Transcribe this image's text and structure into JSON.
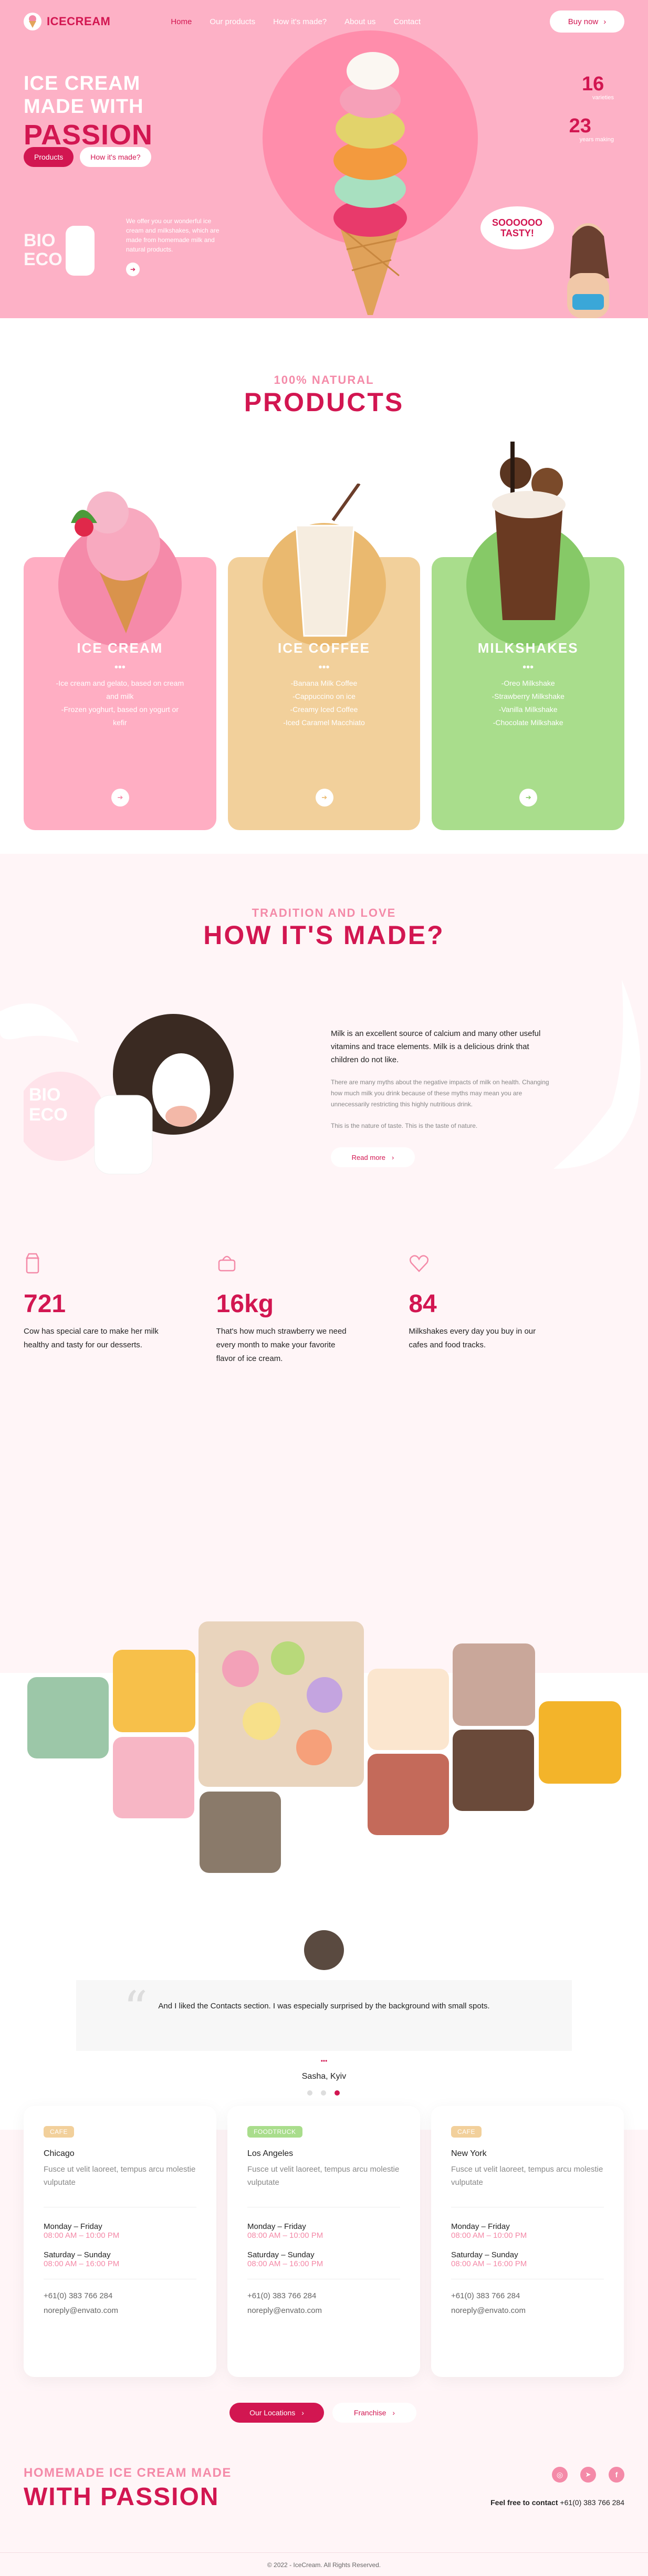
{
  "brand": {
    "name": "ICECREAM"
  },
  "nav": {
    "items": [
      "Home",
      "Our products",
      "How it's made?",
      "About us",
      "Contact"
    ],
    "buy": "Buy now"
  },
  "hero": {
    "title_line1": "ICE CREAM",
    "title_line2": "MADE WITH",
    "title_big": "PASSION",
    "btn_products": "Products",
    "btn_how": "How it's made?",
    "eco": "BIO\nECO",
    "desc": "We offer you our wonderful ice cream and milkshakes, which are made from homemade milk and natural products.",
    "stat1_num": "16",
    "stat1_lbl": "varieties",
    "stat2_num": "23",
    "stat2_lbl": "years making",
    "tasty": "SOOOOOO TASTY!"
  },
  "products": {
    "subtitle": "100% NATURAL",
    "title": "PRODUCTS",
    "cards": [
      {
        "name": "ICE CREAM",
        "items": [
          "-Ice cream and gelato, based on cream and milk",
          "-Frozen yoghurt, based on yogurt or kefir"
        ],
        "color": "#ffaec3",
        "circle": "#f58aa9"
      },
      {
        "name": "ICE COFFEE",
        "items": [
          "-Banana Milk Coffee",
          "-Cappuccino on ice",
          "-Creamy Iced Coffee",
          "-Iced Caramel Macchiato"
        ],
        "color": "#f2d09b",
        "circle": "#eab96f"
      },
      {
        "name": "MILKSHAKES",
        "items": [
          "-Oreo Milkshake",
          "-Strawberry Milkshake",
          "-Vanilla Milkshake",
          "-Chocolate Milkshake"
        ],
        "color": "#a9dd8c",
        "circle": "#86c967"
      }
    ]
  },
  "how": {
    "subtitle": "TRADITION AND LOVE",
    "title": "HOW IT'S MADE?",
    "eco": "BIO\nECO",
    "lead": "Milk is an excellent source of calcium and many other useful vitamins and trace elements. Milk is a delicious drink that children do not like.",
    "p1": "There are many myths about the negative impacts of milk on health. Changing how much milk you drink because of these myths may mean you are unnecessarily restricting this highly nutritious drink.",
    "p2": "This is the nature of taste. This is the taste of nature.",
    "read_more": "Read more",
    "stats": [
      {
        "num": "721",
        "desc": "Cow has special care to make her milk healthy and tasty for our desserts.",
        "icon": "milk-icon"
      },
      {
        "num": "16kg",
        "desc": "That's how much strawberry we need every month to make your favorite flavor of ice cream.",
        "icon": "basket-icon"
      },
      {
        "num": "84",
        "desc": "Milkshakes every day you buy in our cafes and food tracks.",
        "icon": "heart-icon"
      }
    ]
  },
  "testimonial": {
    "quote": "And I liked the Contacts section. I was especially surprised by the background with small spots.",
    "author": "Sasha, Kyiv"
  },
  "locations": {
    "cards": [
      {
        "tag": "CAFE",
        "tag_color": "#f2d09b",
        "city": "Chicago",
        "address": "Fusce ut velit laoreet, tempus arcu molestie vulputate",
        "wk_label": "Monday – Friday",
        "wk_hours": "08:00 AM – 10:00 PM",
        "we_label": "Saturday – Sunday",
        "we_hours": "08:00 AM – 16:00 PM",
        "phone": "+61(0) 383 766 284",
        "email": "noreply@envato.com"
      },
      {
        "tag": "FOODTRUCK",
        "tag_color": "#a9dd8c",
        "city": "Los Angeles",
        "address": "Fusce ut velit laoreet, tempus arcu molestie vulputate",
        "wk_label": "Monday – Friday",
        "wk_hours": "08:00 AM – 10:00 PM",
        "we_label": "Saturday – Sunday",
        "we_hours": "08:00 AM – 16:00 PM",
        "phone": "+61(0) 383 766 284",
        "email": "noreply@envato.com"
      },
      {
        "tag": "CAFE",
        "tag_color": "#f2d09b",
        "city": "New York",
        "address": "Fusce ut velit laoreet, tempus arcu molestie vulputate",
        "wk_label": "Monday – Friday",
        "wk_hours": "08:00 AM – 10:00 PM",
        "we_label": "Saturday – Sunday",
        "we_hours": "08:00 AM – 16:00 PM",
        "phone": "+61(0) 383 766 284",
        "email": "noreply@envato.com"
      }
    ],
    "btn_locations": "Our Locations",
    "btn_franchise": "Franchise"
  },
  "footer": {
    "sub": "HOMEMADE ICE CREAM MADE",
    "title": "WITH PASSION",
    "contact_label": "Feel free to contact",
    "contact_phone": "+61(0) 383 766 284",
    "copyright": "© 2022 - IceCream. All Rights Reserved."
  },
  "colors": {
    "accent": "#d21651",
    "pink": "#fdb1c6",
    "light": "#fff5f7"
  }
}
